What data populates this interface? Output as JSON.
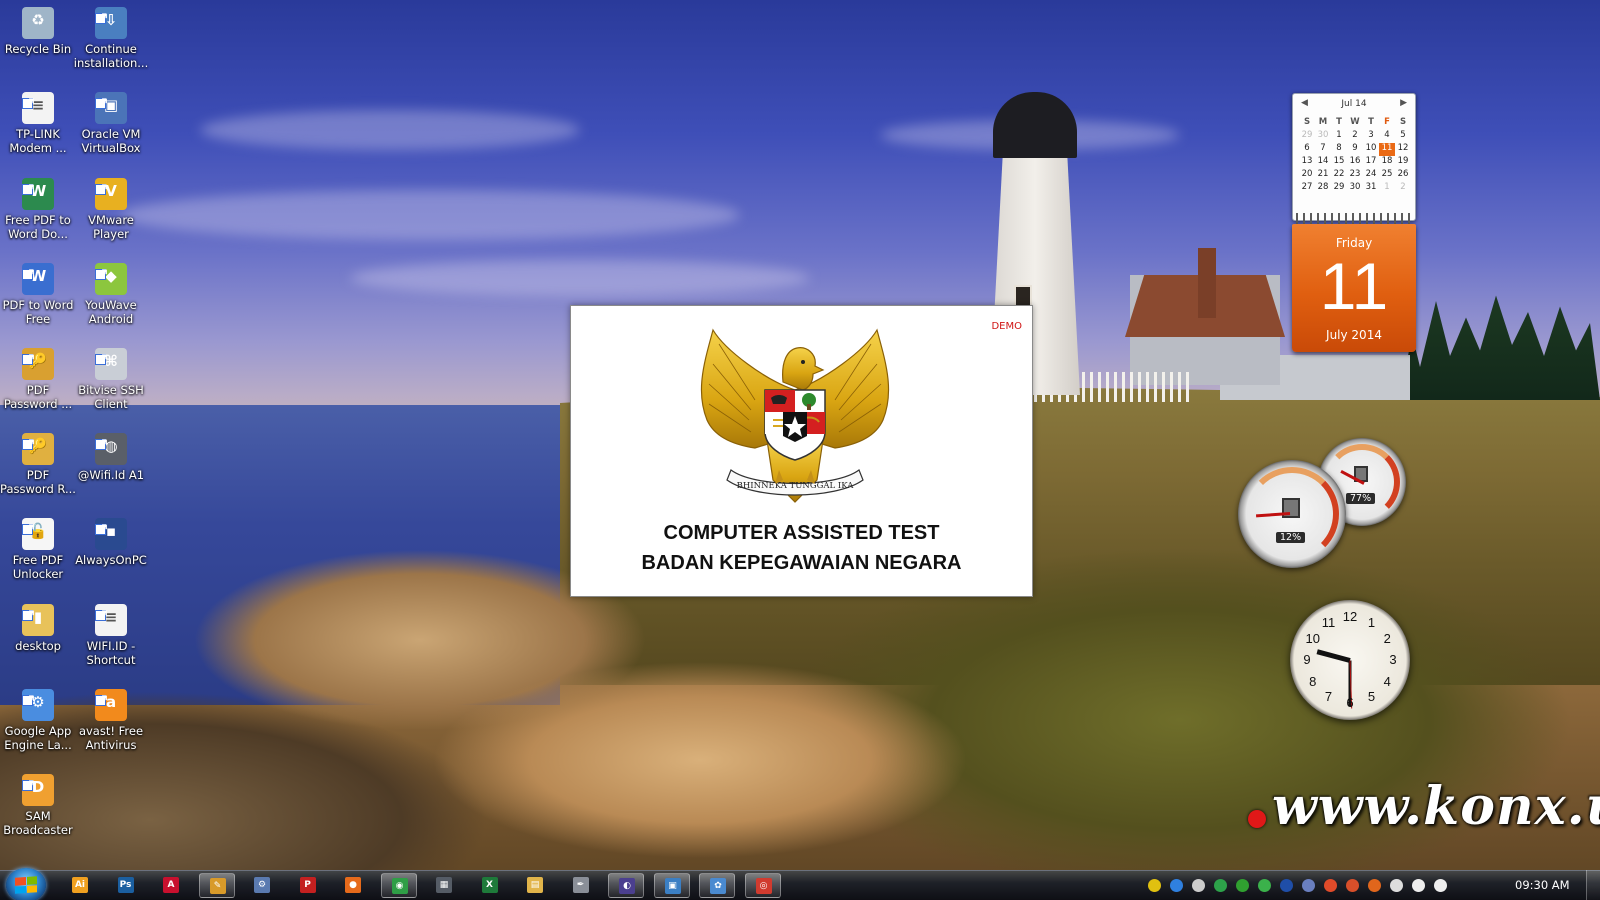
{
  "desktop_icons": [
    {
      "label": "Recycle Bin",
      "icon": "recycle-bin-icon"
    },
    {
      "label": "Continue installation...",
      "icon": "installer-icon"
    },
    {
      "label": "TP-LINK Modem ...",
      "icon": "document-icon"
    },
    {
      "label": "Oracle VM VirtualBox",
      "icon": "virtualbox-icon"
    },
    {
      "label": "Free PDF to Word Do...",
      "icon": "pdf-converter-icon"
    },
    {
      "label": "VMware Player",
      "icon": "vmware-icon"
    },
    {
      "label": "PDF to Word Free",
      "icon": "pdf-word-icon"
    },
    {
      "label": "YouWave Android",
      "icon": "android-icon"
    },
    {
      "label": "PDF Password ...",
      "icon": "pdf-password-icon"
    },
    {
      "label": "Bitvise SSH Client",
      "icon": "ssh-client-icon"
    },
    {
      "label": "PDF Password R...",
      "icon": "pdf-password-recovery-icon"
    },
    {
      "label": "@Wifi.Id A1",
      "icon": "wifi-icon"
    },
    {
      "label": "Free PDF Unlocker",
      "icon": "pdf-unlocker-icon"
    },
    {
      "label": "AlwaysOnPC",
      "icon": "alwaysonpc-icon"
    },
    {
      "label": "desktop",
      "icon": "folder-icon"
    },
    {
      "label": "WIFI.ID - Shortcut",
      "icon": "document-icon"
    },
    {
      "label": "Google App Engine La...",
      "icon": "app-engine-icon"
    },
    {
      "label": "avast! Free Antivirus",
      "icon": "avast-icon"
    },
    {
      "label": "SAM Broadcaster",
      "icon": "sam-broadcaster-icon"
    }
  ],
  "calendar": {
    "month_label": "Jul 14",
    "weekdays": [
      "S",
      "M",
      "T",
      "W",
      "T",
      "F",
      "S"
    ],
    "days": [
      [
        "29",
        "30",
        "1",
        "2",
        "3",
        "4",
        "5"
      ],
      [
        "6",
        "7",
        "8",
        "9",
        "10",
        "11",
        "12"
      ],
      [
        "13",
        "14",
        "15",
        "16",
        "17",
        "18",
        "19"
      ],
      [
        "20",
        "21",
        "22",
        "23",
        "24",
        "25",
        "26"
      ],
      [
        "27",
        "28",
        "29",
        "30",
        "31",
        "1",
        "2"
      ]
    ],
    "today": "11",
    "day_name": "Friday",
    "day_number": "11",
    "month_year": "July 2014",
    "accent_color": "#e8631a"
  },
  "cpu_meter": {
    "cpu_percent": "12%",
    "memory_percent": "77%"
  },
  "clock": {
    "hour_numbers": [
      "12",
      "1",
      "2",
      "3",
      "4",
      "5",
      "6",
      "7",
      "8",
      "9",
      "10",
      "11"
    ]
  },
  "splash": {
    "badge": "DEMO",
    "emblem_motto": "BHINNEKA TUNGGAL IKA",
    "title_line1": "COMPUTER ASSISTED TEST",
    "title_line2": "BADAN KEPEGAWAIAN NEGARA"
  },
  "watermark": "www.konx.us",
  "taskbar": {
    "apps": [
      {
        "name": "illustrator-icon",
        "glyph": "Ai",
        "color": "#f0a020",
        "active": false
      },
      {
        "name": "photoshop-icon",
        "glyph": "Ps",
        "color": "#1b5fa0",
        "active": false
      },
      {
        "name": "acrobat-icon",
        "glyph": "A",
        "color": "#c8102e",
        "active": false
      },
      {
        "name": "cat-app-icon",
        "glyph": "✎",
        "color": "#d89a2a",
        "active": true
      },
      {
        "name": "tools-icon",
        "glyph": "⚙",
        "color": "#5a7ab0",
        "active": false
      },
      {
        "name": "pdf-tool-icon",
        "glyph": "P",
        "color": "#c42020",
        "active": false
      },
      {
        "name": "firefox-icon",
        "glyph": "●",
        "color": "#e66a1b",
        "active": false
      },
      {
        "name": "chrome-icon",
        "glyph": "◉",
        "color": "#2f9e46",
        "active": true
      },
      {
        "name": "calculator-icon",
        "glyph": "▦",
        "color": "#555c66",
        "active": false
      },
      {
        "name": "excel-icon",
        "glyph": "X",
        "color": "#1e7a3a",
        "active": false
      },
      {
        "name": "explorer-icon",
        "glyph": "▤",
        "color": "#e1b44a",
        "active": false
      },
      {
        "name": "feather-icon",
        "glyph": "✒",
        "color": "#8a8f98",
        "active": false
      },
      {
        "name": "eclipse-icon",
        "glyph": "◐",
        "color": "#4b3f8f",
        "active": true
      },
      {
        "name": "remote-desktop-icon",
        "glyph": "▣",
        "color": "#3b7fc4",
        "active": true
      },
      {
        "name": "paint-icon",
        "glyph": "✿",
        "color": "#4a8ad0",
        "active": true
      },
      {
        "name": "media-icon",
        "glyph": "◎",
        "color": "#d13b2f",
        "active": true
      }
    ],
    "tray_icons": [
      {
        "name": "tray-app-icon",
        "color": "#e0c010"
      },
      {
        "name": "security-shield-icon",
        "color": "#2f80e0"
      },
      {
        "name": "sync-icon",
        "color": "#cccccc"
      },
      {
        "name": "network-app-icon",
        "color": "#2da24a"
      },
      {
        "name": "drive-icon",
        "color": "#30a030"
      },
      {
        "name": "status-icon",
        "color": "#3bb14b"
      },
      {
        "name": "bluetooth-icon",
        "color": "#1f4ea8"
      },
      {
        "name": "update-icon",
        "color": "#6a7fc0"
      },
      {
        "name": "network-icon",
        "color": "#e04b2a"
      },
      {
        "name": "flag-icon",
        "color": "#d84f2a"
      },
      {
        "name": "avast-tray-icon",
        "color": "#e0661c"
      },
      {
        "name": "clock-tray-icon",
        "color": "#dddddd"
      },
      {
        "name": "volume-icon",
        "color": "#eeeeee"
      },
      {
        "name": "action-center-icon",
        "color": "#eeeeee"
      }
    ],
    "time": "09:30 AM"
  }
}
